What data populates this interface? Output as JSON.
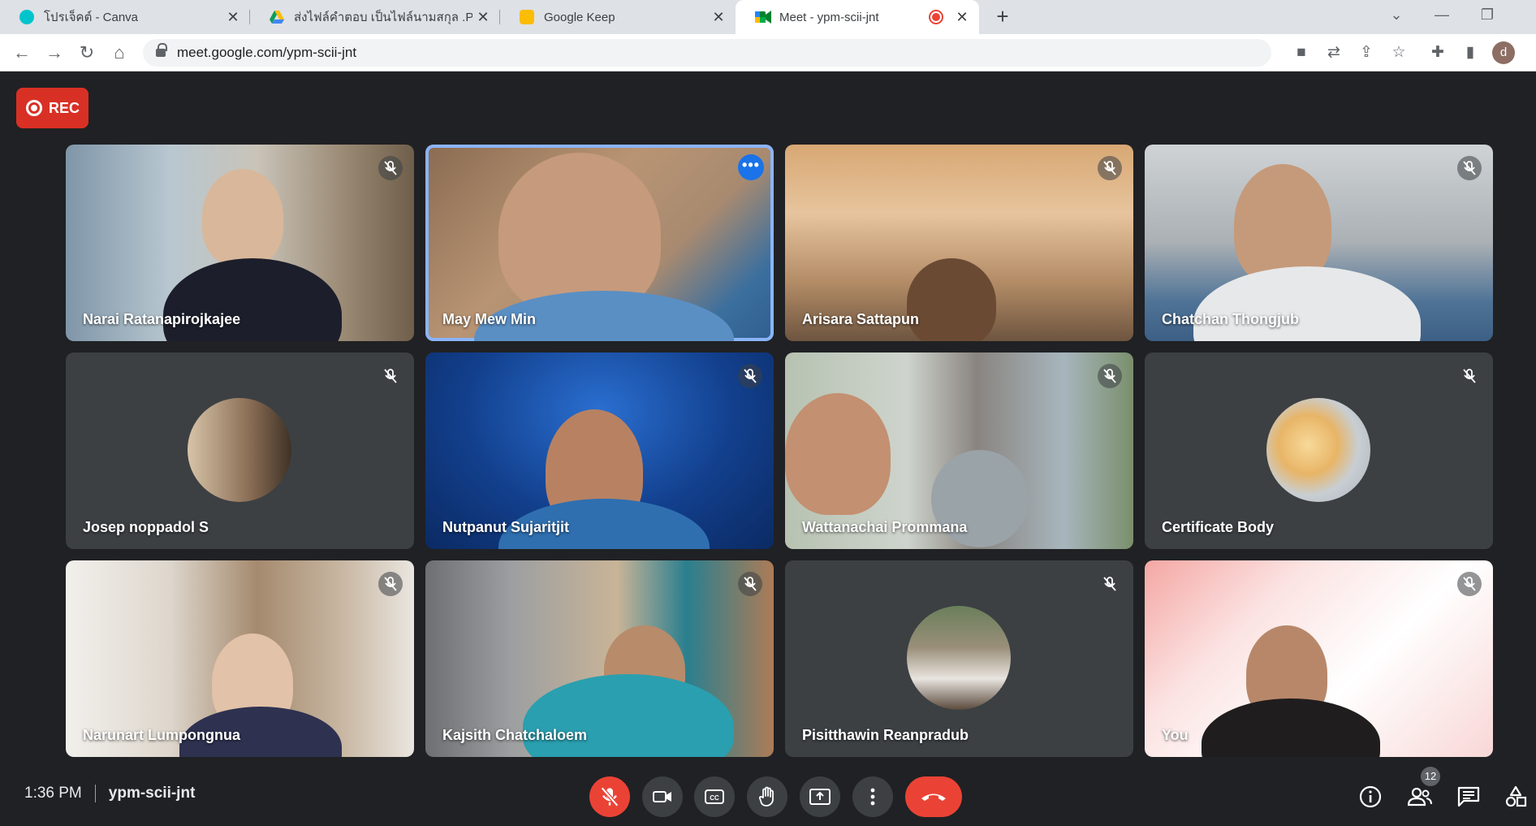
{
  "browser": {
    "tabs": [
      {
        "title": "โปรเจ็คต์ - Canva",
        "favicon_color": "#00c4cc",
        "favicon_icon": "canva-icon"
      },
      {
        "title": "ส่งไฟล์คำตอบ เป็นไฟล์นามสกุล .PDF",
        "favicon_color": "#fbbc04",
        "favicon_icon": "google-drive-icon"
      },
      {
        "title": "Google Keep",
        "favicon_color": "#fbbc04",
        "favicon_icon": "google-keep-icon"
      },
      {
        "title": "Meet - ypm-scii-jnt",
        "favicon_color": "#00832d",
        "favicon_icon": "google-meet-icon",
        "active": true
      }
    ],
    "url": "meet.google.com/ypm-scii-jnt",
    "profile_initial": "d"
  },
  "meet": {
    "rec_label": "REC",
    "time": "1:36 PM",
    "meeting_code": "ypm-scii-jnt",
    "participant_count": "12",
    "tiles": [
      {
        "name": "Narai Ratanapirojkajee",
        "bg": "office"
      },
      {
        "name": "May Mew Min",
        "bg": "warm",
        "speaking": true
      },
      {
        "name": "Arisara Sattapun",
        "bg": "city"
      },
      {
        "name": "Chatchan Thongjub",
        "bg": "room"
      },
      {
        "name": "Josep noppadol S",
        "bg": "avatar"
      },
      {
        "name": "Nutpanut Sujaritjit",
        "bg": "blue"
      },
      {
        "name": "Wattanachai Prommana",
        "bg": "fan"
      },
      {
        "name": "Certificate Body",
        "bg": "avatar"
      },
      {
        "name": "Narunart Lumpongnua",
        "bg": "books"
      },
      {
        "name": "Kajsith Chatchaloem",
        "bg": "shop"
      },
      {
        "name": "Pisitthawin Reanpradub",
        "bg": "avatar"
      },
      {
        "name": "You",
        "bg": "you"
      }
    ]
  }
}
